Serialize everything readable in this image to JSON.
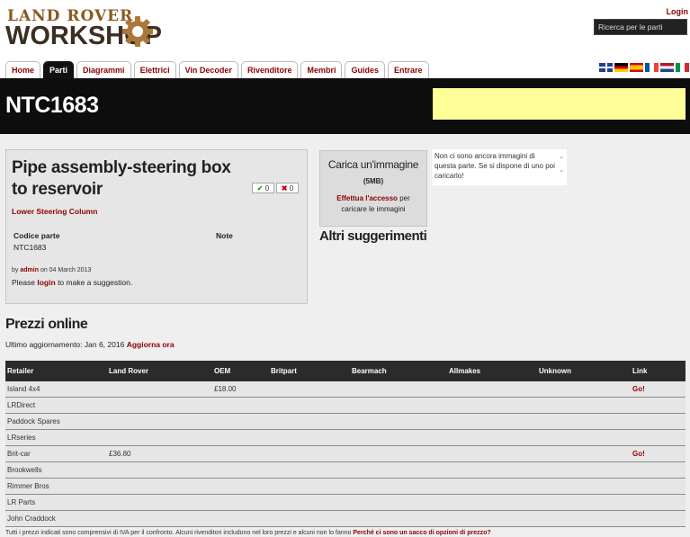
{
  "header": {
    "logo_line1": "LAND ROVER",
    "logo_line2": "WORKSHOP",
    "login": "Login",
    "search_placeholder": "Ricerca per le parti"
  },
  "nav": {
    "tabs": [
      {
        "label": "Home"
      },
      {
        "label": "Parti",
        "active": true
      },
      {
        "label": "Diagrammi"
      },
      {
        "label": "Elettrici"
      },
      {
        "label": "Vin Decoder"
      },
      {
        "label": "Rivenditore"
      },
      {
        "label": "Membri"
      },
      {
        "label": "Guides"
      },
      {
        "label": "Entrare"
      }
    ]
  },
  "flags": [
    "gb",
    "de",
    "es",
    "fr",
    "nl",
    "it"
  ],
  "banner": {
    "title": "NTC1683",
    "ad_color": "#ffff99"
  },
  "part": {
    "name": "Pipe assembly-steering box to reservoir",
    "category": "Lower Steering Column",
    "upvotes": "0",
    "downvotes": "0",
    "code_label": "Codice parte",
    "code_value": "NTC1683",
    "note_label": "Note",
    "by_prefix": "by",
    "author": "admin",
    "date_text": "on 04 March 2013",
    "suggest_prefix": "Please",
    "suggest_link": "login",
    "suggest_suffix": "to make a suggestion."
  },
  "upload": {
    "title": "Carica un'immagine",
    "size": "(5MB)",
    "link": "Effettua l'accesso",
    "text": "per caricare le immagini",
    "no_images": "Non ci sono ancora immagini di questa parte. Se si dispone di uno poi caricarlo!",
    "altri": "Altri suggerimenti"
  },
  "prices": {
    "heading": "Prezzi online",
    "updated_label": "Ultimo aggiornamento: Jan 6, 2016",
    "refresh": "Aggiorna ora",
    "columns": [
      "Retailer",
      "Land Rover",
      "OEM",
      "Britpart",
      "Bearmach",
      "Allmakes",
      "Unknown",
      "Link"
    ],
    "rows": [
      [
        "Island 4x4",
        "",
        "£18.00",
        "",
        "",
        "",
        "",
        "Go!"
      ],
      [
        "LRDirect",
        "",
        "",
        "",
        "",
        "",
        "",
        ""
      ],
      [
        "Paddock Spares",
        "",
        "",
        "",
        "",
        "",
        "",
        ""
      ],
      [
        "LRseries",
        "",
        "",
        "",
        "",
        "",
        "",
        ""
      ],
      [
        "Brit-car",
        "£36.80",
        "",
        "",
        "",
        "",
        "",
        "Go!"
      ],
      [
        "Brookwells",
        "",
        "",
        "",
        "",
        "",
        "",
        ""
      ],
      [
        "Rimmer Bros",
        "",
        "",
        "",
        "",
        "",
        "",
        ""
      ],
      [
        "LR Parts",
        "",
        "",
        "",
        "",
        "",
        "",
        ""
      ],
      [
        "John Craddock",
        "",
        "",
        "",
        "",
        "",
        "",
        ""
      ]
    ],
    "footnote": "Tutti i prezzi indicati sono comprensivi di IVA per il confronto. Alcuni rivenditori includono nel loro prezzi e alcuni non lo fanno",
    "footnote_link": "Perché ci sono un sacco di opzioni di prezzo?"
  },
  "colors": {
    "accent": "#8b0000",
    "banner": "#0d0d0d",
    "ad": "#ffff99"
  }
}
